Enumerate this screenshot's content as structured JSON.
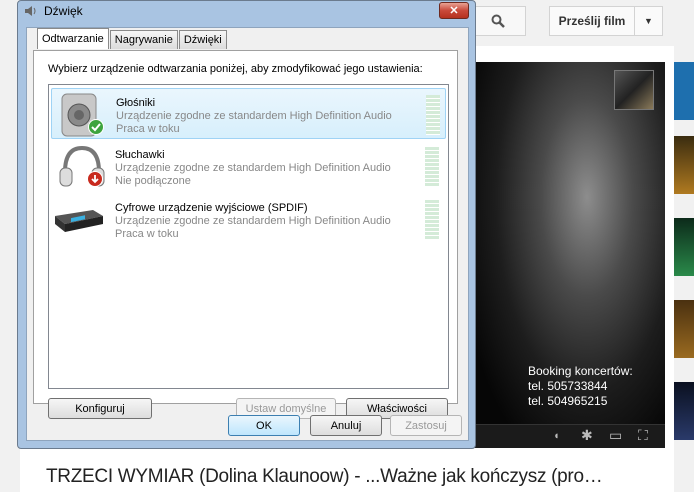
{
  "window": {
    "title": "Dźwięk",
    "close_label": "✕"
  },
  "tabs": [
    {
      "label": "Odtwarzanie",
      "active": true
    },
    {
      "label": "Nagrywanie",
      "active": false
    },
    {
      "label": "Dźwięki",
      "active": false
    }
  ],
  "instruction": "Wybierz urządzenie odtwarzania poniżej, aby zmodyfikować jego ustawienia:",
  "devices": [
    {
      "name": "Głośniki",
      "description": "Urządzenie zgodne ze standardem High Definition Audio",
      "status": "Praca w toku",
      "icon": "speaker-icon",
      "badge": "check-badge-icon",
      "selected": true
    },
    {
      "name": "Słuchawki",
      "description": "Urządzenie zgodne ze standardem High Definition Audio",
      "status": "Nie podłączone",
      "icon": "headphones-icon",
      "badge": "unplugged-badge-icon",
      "selected": false
    },
    {
      "name": "Cyfrowe urządzenie wyjściowe (SPDIF)",
      "description": "Urządzenie zgodne ze standardem High Definition Audio",
      "status": "Praca w toku",
      "icon": "spdif-device-icon",
      "selected": false
    }
  ],
  "buttons": {
    "configure": "Konfiguruj",
    "set_default": "Ustaw domyślne",
    "properties": "Właściwości",
    "ok": "OK",
    "cancel": "Anuluj",
    "apply": "Zastosuj"
  },
  "background_page": {
    "upload_label": "Prześlij film",
    "booking_lines": [
      "Booking koncertów:",
      "tel. 505733844",
      "tel. 504965215"
    ],
    "video_title": "TRZECI WYMIAR (Dolina Klaunoow) - ...Ważne jak kończysz (pro…"
  },
  "colors": {
    "accent_blue": "#a9c4e2",
    "selection": "#d7effc",
    "close_red": "#c9493a"
  }
}
